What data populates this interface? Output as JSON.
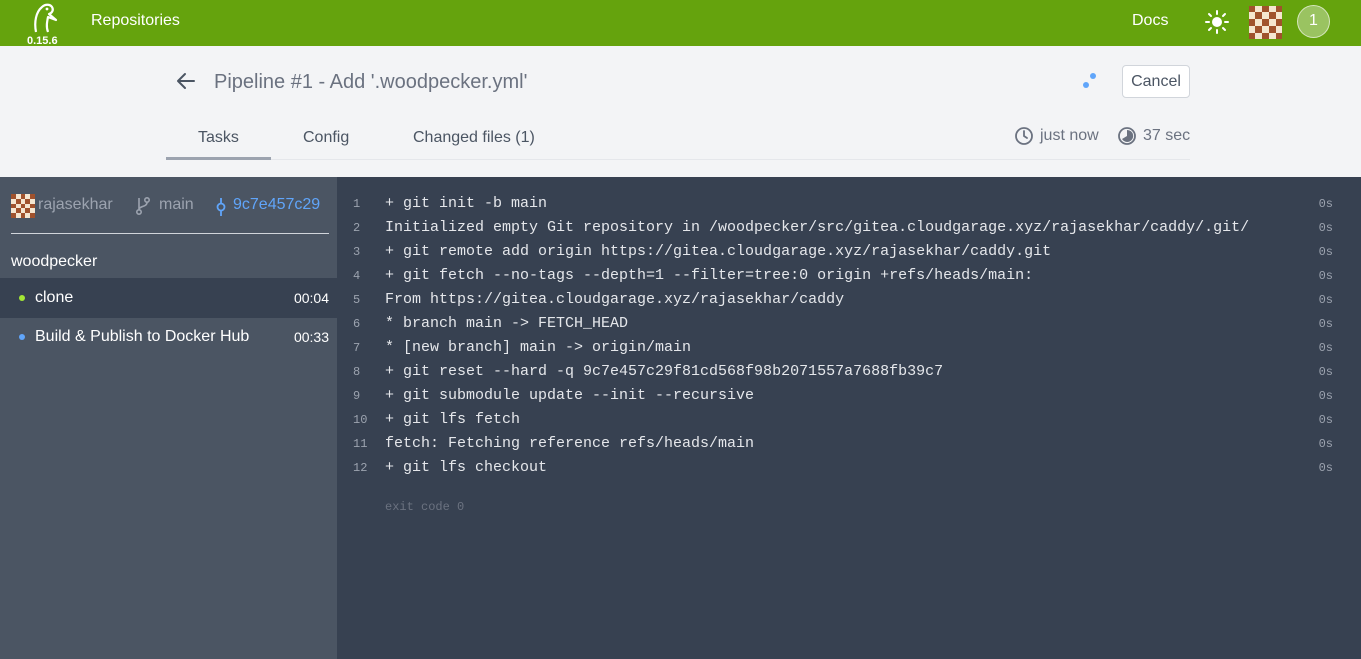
{
  "nav": {
    "version": "0.15.6",
    "repositories_label": "Repositories",
    "docs_label": "Docs",
    "notification_count": "1",
    "colors": {
      "bar": "#65a30d"
    }
  },
  "header": {
    "pipeline_number": "Pipeline #1",
    "separator": "-",
    "commit_message": "Add '.woodpecker.yml'",
    "cancel_label": "Cancel",
    "tabs": [
      {
        "label": "Tasks",
        "active": true
      },
      {
        "label": "Config",
        "active": false
      },
      {
        "label": "Changed files (1)",
        "active": false
      }
    ],
    "created": "just now",
    "duration": "37 sec"
  },
  "sidebar": {
    "author": "rajasekhar",
    "branch": "main",
    "commit_sha": "9c7e457c29",
    "workflow_name": "woodpecker",
    "steps": [
      {
        "name": "clone",
        "duration": "00:04",
        "status_color": "#a3e635",
        "active": true
      },
      {
        "name": "Build & Publish to Docker Hub",
        "duration": "00:33",
        "status_color": "#60a5fa",
        "active": false
      }
    ]
  },
  "log": {
    "lines": [
      {
        "num": "1",
        "text": "+ git init -b main",
        "time": "0s"
      },
      {
        "num": "2",
        "text": "Initialized empty Git repository in /woodpecker/src/gitea.cloudgarage.xyz/rajasekhar/caddy/.git/",
        "time": "0s"
      },
      {
        "num": "3",
        "text": "+ git remote add origin https://gitea.cloudgarage.xyz/rajasekhar/caddy.git",
        "time": "0s"
      },
      {
        "num": "4",
        "text": "+ git fetch --no-tags --depth=1 --filter=tree:0 origin +refs/heads/main:",
        "time": "0s"
      },
      {
        "num": "5",
        "text": "From https://gitea.cloudgarage.xyz/rajasekhar/caddy",
        "time": "0s"
      },
      {
        "num": "6",
        "text": "* branch main -> FETCH_HEAD",
        "time": "0s"
      },
      {
        "num": "7",
        "text": "* [new branch] main -> origin/main",
        "time": "0s"
      },
      {
        "num": "8",
        "text": "+ git reset --hard -q 9c7e457c29f81cd568f98b2071557a7688fb39c7",
        "time": "0s"
      },
      {
        "num": "9",
        "text": "+ git submodule update --init --recursive",
        "time": "0s"
      },
      {
        "num": "10",
        "text": "+ git lfs fetch",
        "time": "0s"
      },
      {
        "num": "11",
        "text": "fetch: Fetching reference refs/heads/main",
        "time": "0s"
      },
      {
        "num": "12",
        "text": "+ git lfs checkout",
        "time": "0s"
      }
    ],
    "exit_code": "exit code 0"
  }
}
